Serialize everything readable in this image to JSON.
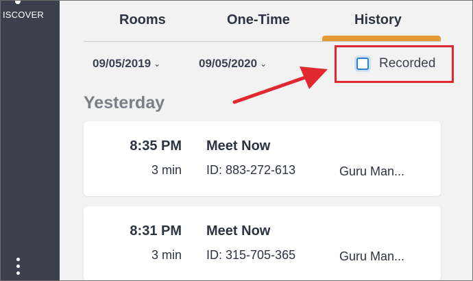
{
  "sidebar": {
    "nav_label": "ISCOVER",
    "more_icon": "more-vertical-icon"
  },
  "tabs": [
    {
      "label": "Rooms",
      "active": false
    },
    {
      "label": "One-Time",
      "active": false
    },
    {
      "label": "History",
      "active": true
    }
  ],
  "filters": {
    "date_from": "09/05/2019",
    "date_to": "09/05/2020",
    "recorded_label": "Recorded",
    "recorded_checked": false
  },
  "annotation": {
    "box_color": "#e0282e",
    "arrow_color": "#e0282e"
  },
  "history": {
    "section_title": "Yesterday",
    "meetings": [
      {
        "time": "8:35 PM",
        "duration": "3 min",
        "title": "Meet Now",
        "id": "ID: 883-272-613",
        "host": "Guru Man..."
      },
      {
        "time": "8:31 PM",
        "duration": "3 min",
        "title": "Meet Now",
        "id": "ID: 315-705-365",
        "host": "Guru Man..."
      }
    ]
  },
  "colors": {
    "accent_tab": "#e59a38",
    "sidebar_bg": "#3a414c",
    "checkbox_blue": "#2a7fd3"
  }
}
